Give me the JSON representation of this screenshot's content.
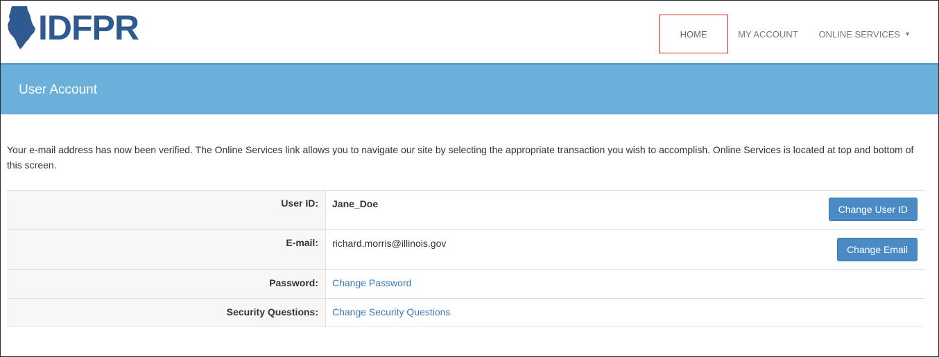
{
  "header": {
    "logo_text": "IDFPR",
    "nav": {
      "home": "HOME",
      "my_account": "MY ACCOUNT",
      "online_services": "ONLINE SERVICES",
      "dropdown_icon": "caret-down-icon"
    }
  },
  "banner": {
    "title": "User Account"
  },
  "intro_text": "Your e-mail address has now been verified. The Online Services link allows you to navigate our site by selecting the appropriate transaction you wish to accomplish. Online Services is located at top and bottom of this screen.",
  "account": {
    "rows": [
      {
        "label": "User ID:",
        "value": "Jane_Doe",
        "button": "Change User ID"
      },
      {
        "label": "E-mail:",
        "value": "richard.morris@illinois.gov",
        "button": "Change Email"
      },
      {
        "label": "Password:",
        "link": "Change Password"
      },
      {
        "label": "Security Questions:",
        "link": "Change Security Questions"
      }
    ]
  },
  "colors": {
    "brand": "#2f5a8f",
    "banner": "#6bb0da",
    "button": "#4a8bc6",
    "link": "#3a7ab8",
    "highlight": "#e02020"
  }
}
